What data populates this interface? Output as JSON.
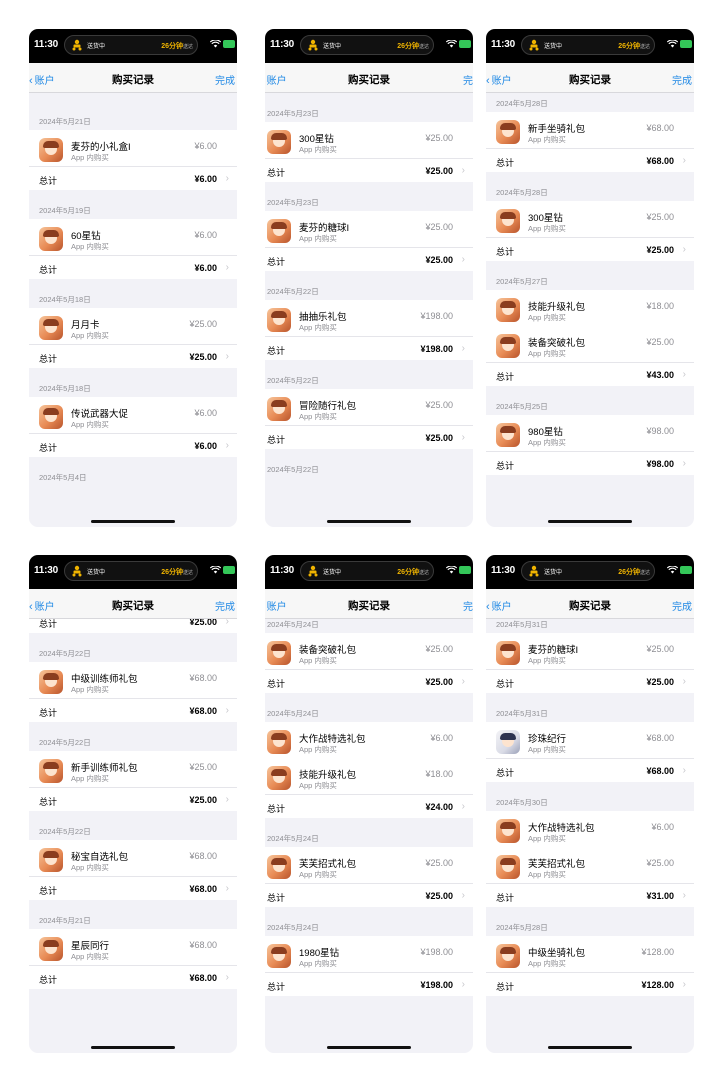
{
  "common": {
    "time": "11:30",
    "delivery": "送货中",
    "eta_main": "26分钟",
    "eta_sub": "送达",
    "back_label": "账户",
    "title": "购买记录",
    "done_label": "完成",
    "total_label": "总计",
    "subtitle": "App 内购买"
  },
  "phones": [
    {
      "sections": [
        {
          "date": "2024年5月21日",
          "items": [
            {
              "name": "麦芬的小礼盒I",
              "price": "¥6.00"
            }
          ],
          "total": "¥6.00"
        },
        {
          "date": "2024年5月19日",
          "items": [
            {
              "name": "60星钻",
              "price": "¥6.00"
            }
          ],
          "total": "¥6.00"
        },
        {
          "date": "2024年5月18日",
          "items": [
            {
              "name": "月月卡",
              "price": "¥25.00"
            }
          ],
          "total": "¥25.00"
        },
        {
          "date": "2024年5月18日",
          "items": [
            {
              "name": "传说武器大促",
              "price": "¥6.00"
            }
          ],
          "total": "¥6.00"
        },
        {
          "date": "2024年5月4日",
          "items": [],
          "total": null
        }
      ]
    },
    {
      "sections": [
        {
          "date": "2024年5月23日",
          "items": [
            {
              "name": "300星钻",
              "price": "¥25.00"
            }
          ],
          "total": "¥25.00"
        },
        {
          "date": "2024年5月23日",
          "items": [
            {
              "name": "麦芬的糖球I",
              "price": "¥25.00"
            }
          ],
          "total": "¥25.00"
        },
        {
          "date": "2024年5月22日",
          "items": [
            {
              "name": "抽抽乐礼包",
              "price": "¥198.00"
            }
          ],
          "total": "¥198.00"
        },
        {
          "date": "2024年5月22日",
          "items": [
            {
              "name": "冒险随行礼包",
              "price": "¥25.00"
            }
          ],
          "total": "¥25.00"
        },
        {
          "date": "2024年5月22日",
          "items": [],
          "total": null
        }
      ]
    },
    {
      "sections": [
        {
          "date": "2024年5月28日",
          "items": [
            {
              "name": "新手坐骑礼包",
              "price": "¥68.00"
            }
          ],
          "total": "¥68.00"
        },
        {
          "date": "2024年5月28日",
          "items": [
            {
              "name": "300星钻",
              "price": "¥25.00"
            }
          ],
          "total": "¥25.00"
        },
        {
          "date": "2024年5月27日",
          "items": [
            {
              "name": "技能升级礼包",
              "price": "¥18.00"
            },
            {
              "name": "装备突破礼包",
              "price": "¥25.00"
            }
          ],
          "total": "¥43.00"
        },
        {
          "date": "2024年5月25日",
          "items": [
            {
              "name": "980星钻",
              "price": "¥98.00"
            }
          ],
          "total": "¥98.00"
        }
      ]
    },
    {
      "sections": [
        {
          "date": "",
          "items": [],
          "total": "¥25.00"
        },
        {
          "date": "2024年5月22日",
          "items": [
            {
              "name": "中级训练师礼包",
              "price": "¥68.00"
            }
          ],
          "total": "¥68.00"
        },
        {
          "date": "2024年5月22日",
          "items": [
            {
              "name": "新手训练师礼包",
              "price": "¥25.00"
            }
          ],
          "total": "¥25.00"
        },
        {
          "date": "2024年5月22日",
          "items": [
            {
              "name": "秘宝自选礼包",
              "price": "¥68.00"
            }
          ],
          "total": "¥68.00"
        },
        {
          "date": "2024年5月21日",
          "items": [
            {
              "name": "星辰同行",
              "price": "¥68.00"
            }
          ],
          "total": "¥68.00"
        }
      ]
    },
    {
      "sections": [
        {
          "date": "2024年5月24日",
          "items": [
            {
              "name": "装备突破礼包",
              "price": "¥25.00"
            }
          ],
          "total": "¥25.00"
        },
        {
          "date": "2024年5月24日",
          "items": [
            {
              "name": "大作战特选礼包",
              "price": "¥6.00"
            },
            {
              "name": "技能升级礼包",
              "price": "¥18.00"
            }
          ],
          "total": "¥24.00"
        },
        {
          "date": "2024年5月24日",
          "items": [
            {
              "name": "芙芙招式礼包",
              "price": "¥25.00"
            }
          ],
          "total": "¥25.00"
        },
        {
          "date": "2024年5月24日",
          "items": [
            {
              "name": "1980星钻",
              "price": "¥198.00"
            }
          ],
          "total": "¥198.00"
        }
      ]
    },
    {
      "sections": [
        {
          "date": "2024年5月31日",
          "items": [
            {
              "name": "麦芬的糖球I",
              "price": "¥25.00"
            }
          ],
          "total": "¥25.00"
        },
        {
          "date": "2024年5月31日",
          "items": [
            {
              "name": "珍珠纪行",
              "price": "¥68.00",
              "icon": "alt"
            }
          ],
          "total": "¥68.00"
        },
        {
          "date": "2024年5月30日",
          "items": [
            {
              "name": "大作战特选礼包",
              "price": "¥6.00"
            },
            {
              "name": "芙芙招式礼包",
              "price": "¥25.00"
            }
          ],
          "total": "¥31.00"
        },
        {
          "date": "2024年5月28日",
          "items": [
            {
              "name": "中级坐骑礼包",
              "price": "¥128.00"
            }
          ],
          "total": "¥128.00"
        }
      ]
    }
  ]
}
